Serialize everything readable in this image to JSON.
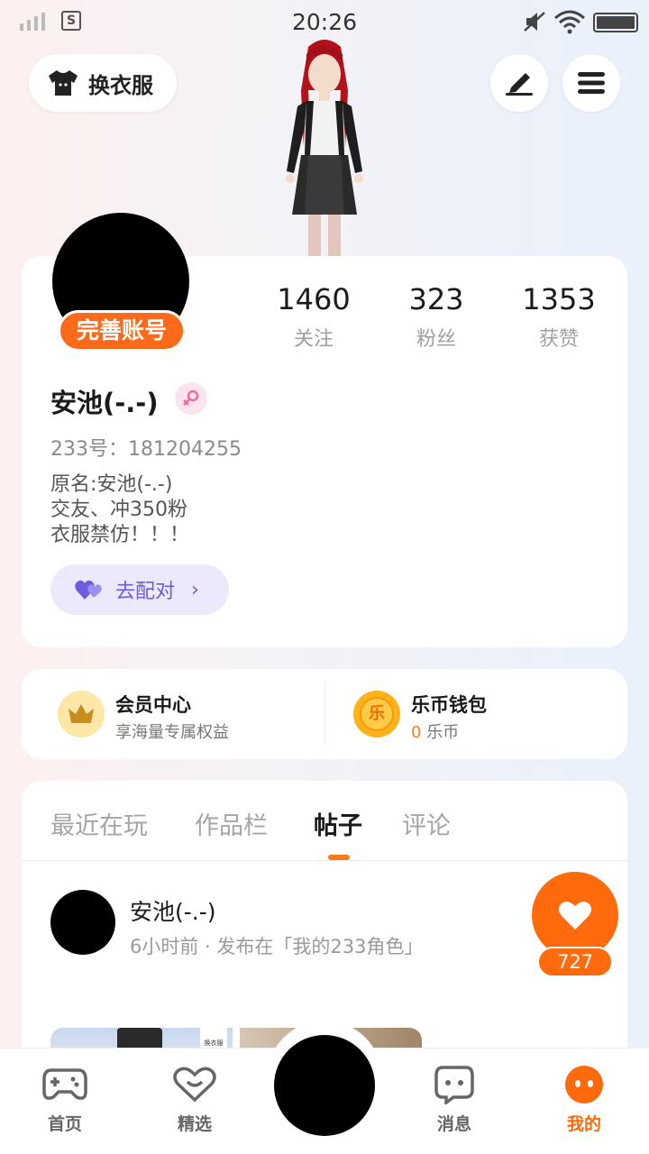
{
  "status_bar": {
    "time": "20:26",
    "sim_label": "S"
  },
  "header": {
    "outfit_button": "换衣服"
  },
  "profile": {
    "complete_badge": "完善账号",
    "stats": [
      {
        "value": "1460",
        "label": "关注"
      },
      {
        "value": "323",
        "label": "粉丝"
      },
      {
        "value": "1353",
        "label": "获赞"
      }
    ],
    "name": "安池(-.-)",
    "id_line": "233号：181204255",
    "bio": [
      "原名:安池(-.-)",
      "交友、冲350粉",
      "衣服禁仿！！！"
    ],
    "match_button": "去配对"
  },
  "wallet": {
    "vip_title": "会员中心",
    "vip_sub": "享海量专属权益",
    "coin_icon_text": "乐",
    "coin_title": "乐币钱包",
    "coin_amount": "0",
    "coin_unit": "乐币"
  },
  "tabs": [
    "最近在玩",
    "作品栏",
    "帖子",
    "评论"
  ],
  "active_tab": "帖子",
  "post": {
    "author": "安池(-.-)",
    "meta": "6小时前 · 发布在「我的233角色」",
    "likes": "727",
    "thumb_watermark": "换衣服"
  },
  "bottom_nav": [
    {
      "label": "首页",
      "icon": "gamepad-icon"
    },
    {
      "label": "精选",
      "icon": "heart-chat-icon"
    },
    {
      "label": "消息",
      "icon": "message-icon"
    },
    {
      "label": "我的",
      "icon": "face-icon"
    }
  ],
  "colors": {
    "accent": "#ff6a0c",
    "match": "#6b5ce0",
    "text": "#1a1a1a",
    "muted": "#a0a0a0"
  }
}
